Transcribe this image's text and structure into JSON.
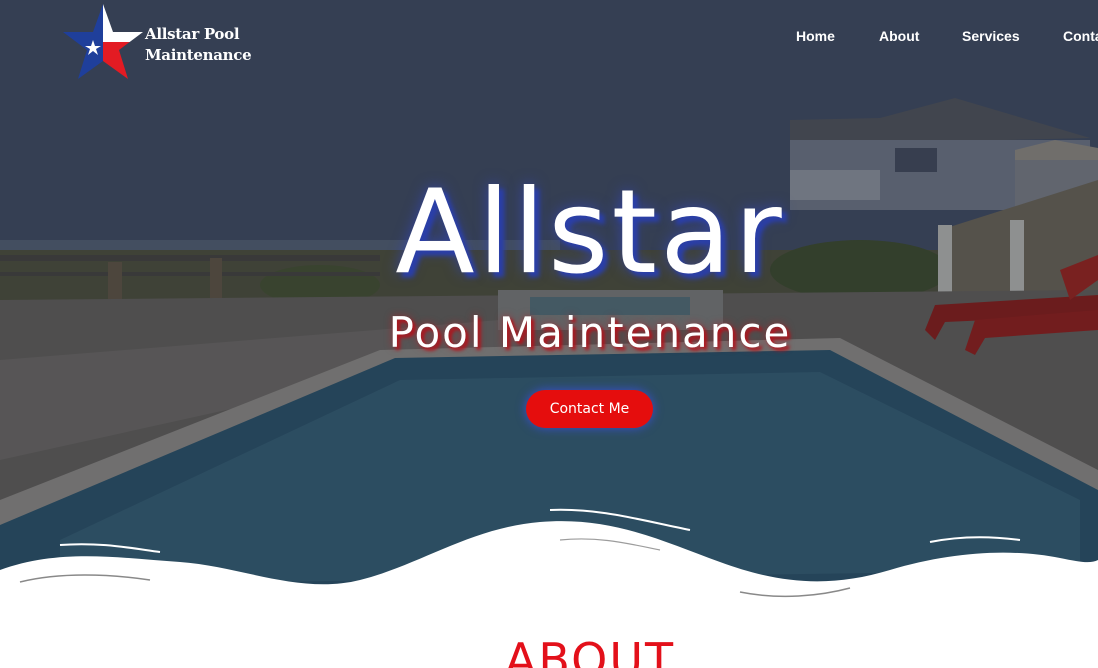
{
  "brand": {
    "name_line1": "Allstar Pool",
    "name_line2": "Maintenance",
    "logo_icon": "texas-star-icon",
    "colors": {
      "blue": "#1f3f9b",
      "red": "#e31b23",
      "white": "#ffffff"
    }
  },
  "nav": {
    "items": [
      {
        "label": "Home"
      },
      {
        "label": "About"
      },
      {
        "label": "Services"
      },
      {
        "label": "Conta"
      }
    ]
  },
  "hero": {
    "title": "Allstar",
    "subtitle": "Pool Maintenance",
    "cta_label": "Contact Me",
    "cta_color": "#e50d0d"
  },
  "about": {
    "heading": "ABOUT"
  }
}
